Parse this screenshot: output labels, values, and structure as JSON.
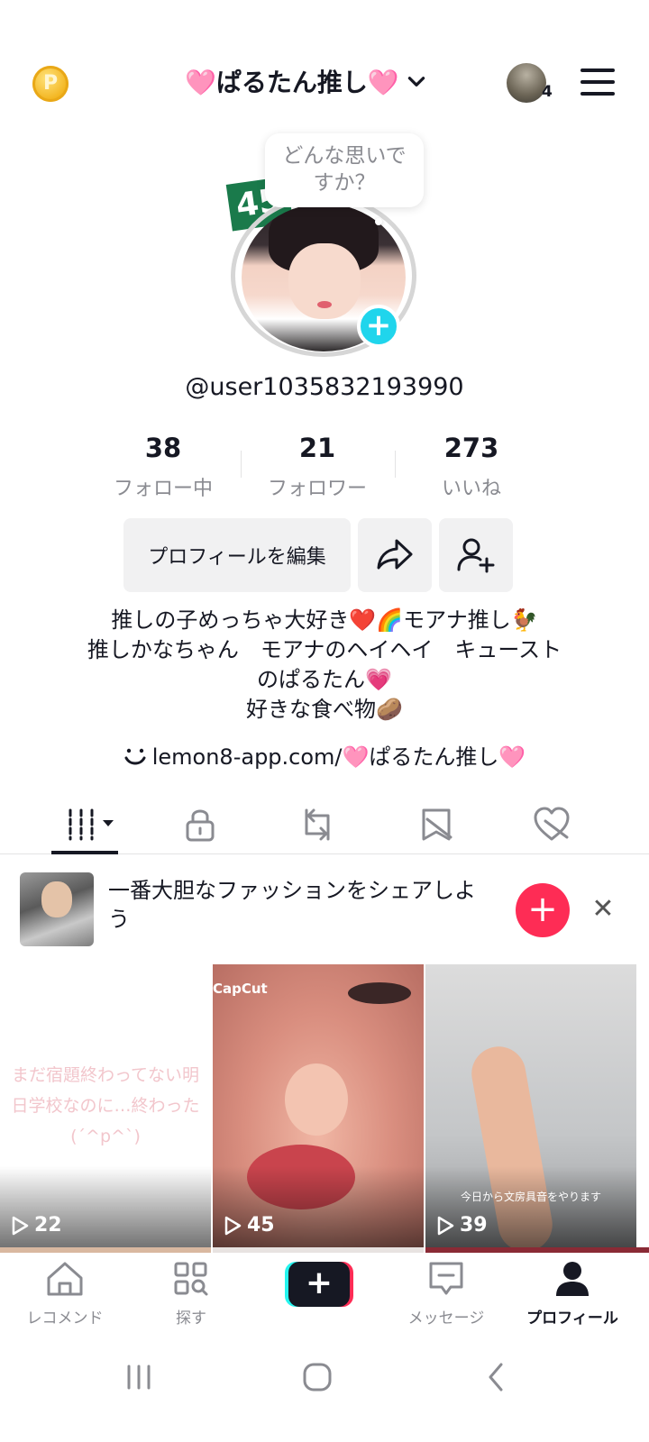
{
  "header": {
    "coin_label": "P",
    "title": "🩷ぱるたん推し🩷",
    "notification_count": "4"
  },
  "profile": {
    "badge": "45",
    "bubble_text_line1": "どんな思いで",
    "bubble_text_line2": "すか？",
    "username": "@user1035832193990",
    "stats": [
      {
        "value": "38",
        "label": "フォロー中"
      },
      {
        "value": "21",
        "label": "フォロワー"
      },
      {
        "value": "273",
        "label": "いいね"
      }
    ],
    "edit_button": "プロフィールを編集",
    "bio": [
      "推しの子めっちゃ大好き❤️🌈モアナ推し🐓",
      "推しかなちゃん　モアナのヘイヘイ　キュースト",
      "のぱるたん💗",
      "好きな食べ物🥔"
    ],
    "link": "lemon8-app.com/🩷ぱるたん推し🩷"
  },
  "banner": {
    "text": "一番大胆なファッションをシェアしよう"
  },
  "videos": [
    {
      "views": "22",
      "overlay_line1": "まだ宿題終わってない明",
      "overlay_line2": "日学校なのに…終わった",
      "overlay_line3": "(´^p^`)"
    },
    {
      "views": "45",
      "watermark": "CapCut"
    },
    {
      "views": "39",
      "caption": "今日から文房具音をやります"
    }
  ],
  "bottom_nav": [
    {
      "label": "レコメンド"
    },
    {
      "label": "探す"
    },
    {
      "label": "メッセージ"
    },
    {
      "label": "プロフィール"
    }
  ],
  "colors": {
    "accent_red": "#fe2c55",
    "accent_cyan": "#20d5ec",
    "text_primary": "#161823",
    "text_secondary": "#8a8b91",
    "button_bg": "#f1f1f2"
  }
}
